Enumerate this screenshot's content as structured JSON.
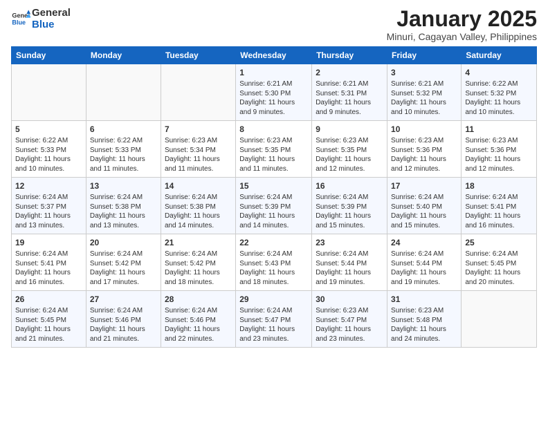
{
  "header": {
    "logo_general": "General",
    "logo_blue": "Blue",
    "month_title": "January 2025",
    "location": "Minuri, Cagayan Valley, Philippines"
  },
  "weekdays": [
    "Sunday",
    "Monday",
    "Tuesday",
    "Wednesday",
    "Thursday",
    "Friday",
    "Saturday"
  ],
  "weeks": [
    [
      {
        "day": "",
        "text": ""
      },
      {
        "day": "",
        "text": ""
      },
      {
        "day": "",
        "text": ""
      },
      {
        "day": "1",
        "text": "Sunrise: 6:21 AM\nSunset: 5:30 PM\nDaylight: 11 hours and 9 minutes."
      },
      {
        "day": "2",
        "text": "Sunrise: 6:21 AM\nSunset: 5:31 PM\nDaylight: 11 hours and 9 minutes."
      },
      {
        "day": "3",
        "text": "Sunrise: 6:21 AM\nSunset: 5:32 PM\nDaylight: 11 hours and 10 minutes."
      },
      {
        "day": "4",
        "text": "Sunrise: 6:22 AM\nSunset: 5:32 PM\nDaylight: 11 hours and 10 minutes."
      }
    ],
    [
      {
        "day": "5",
        "text": "Sunrise: 6:22 AM\nSunset: 5:33 PM\nDaylight: 11 hours and 10 minutes."
      },
      {
        "day": "6",
        "text": "Sunrise: 6:22 AM\nSunset: 5:33 PM\nDaylight: 11 hours and 11 minutes."
      },
      {
        "day": "7",
        "text": "Sunrise: 6:23 AM\nSunset: 5:34 PM\nDaylight: 11 hours and 11 minutes."
      },
      {
        "day": "8",
        "text": "Sunrise: 6:23 AM\nSunset: 5:35 PM\nDaylight: 11 hours and 11 minutes."
      },
      {
        "day": "9",
        "text": "Sunrise: 6:23 AM\nSunset: 5:35 PM\nDaylight: 11 hours and 12 minutes."
      },
      {
        "day": "10",
        "text": "Sunrise: 6:23 AM\nSunset: 5:36 PM\nDaylight: 11 hours and 12 minutes."
      },
      {
        "day": "11",
        "text": "Sunrise: 6:23 AM\nSunset: 5:36 PM\nDaylight: 11 hours and 12 minutes."
      }
    ],
    [
      {
        "day": "12",
        "text": "Sunrise: 6:24 AM\nSunset: 5:37 PM\nDaylight: 11 hours and 13 minutes."
      },
      {
        "day": "13",
        "text": "Sunrise: 6:24 AM\nSunset: 5:38 PM\nDaylight: 11 hours and 13 minutes."
      },
      {
        "day": "14",
        "text": "Sunrise: 6:24 AM\nSunset: 5:38 PM\nDaylight: 11 hours and 14 minutes."
      },
      {
        "day": "15",
        "text": "Sunrise: 6:24 AM\nSunset: 5:39 PM\nDaylight: 11 hours and 14 minutes."
      },
      {
        "day": "16",
        "text": "Sunrise: 6:24 AM\nSunset: 5:39 PM\nDaylight: 11 hours and 15 minutes."
      },
      {
        "day": "17",
        "text": "Sunrise: 6:24 AM\nSunset: 5:40 PM\nDaylight: 11 hours and 15 minutes."
      },
      {
        "day": "18",
        "text": "Sunrise: 6:24 AM\nSunset: 5:41 PM\nDaylight: 11 hours and 16 minutes."
      }
    ],
    [
      {
        "day": "19",
        "text": "Sunrise: 6:24 AM\nSunset: 5:41 PM\nDaylight: 11 hours and 16 minutes."
      },
      {
        "day": "20",
        "text": "Sunrise: 6:24 AM\nSunset: 5:42 PM\nDaylight: 11 hours and 17 minutes."
      },
      {
        "day": "21",
        "text": "Sunrise: 6:24 AM\nSunset: 5:42 PM\nDaylight: 11 hours and 18 minutes."
      },
      {
        "day": "22",
        "text": "Sunrise: 6:24 AM\nSunset: 5:43 PM\nDaylight: 11 hours and 18 minutes."
      },
      {
        "day": "23",
        "text": "Sunrise: 6:24 AM\nSunset: 5:44 PM\nDaylight: 11 hours and 19 minutes."
      },
      {
        "day": "24",
        "text": "Sunrise: 6:24 AM\nSunset: 5:44 PM\nDaylight: 11 hours and 19 minutes."
      },
      {
        "day": "25",
        "text": "Sunrise: 6:24 AM\nSunset: 5:45 PM\nDaylight: 11 hours and 20 minutes."
      }
    ],
    [
      {
        "day": "26",
        "text": "Sunrise: 6:24 AM\nSunset: 5:45 PM\nDaylight: 11 hours and 21 minutes."
      },
      {
        "day": "27",
        "text": "Sunrise: 6:24 AM\nSunset: 5:46 PM\nDaylight: 11 hours and 21 minutes."
      },
      {
        "day": "28",
        "text": "Sunrise: 6:24 AM\nSunset: 5:46 PM\nDaylight: 11 hours and 22 minutes."
      },
      {
        "day": "29",
        "text": "Sunrise: 6:24 AM\nSunset: 5:47 PM\nDaylight: 11 hours and 23 minutes."
      },
      {
        "day": "30",
        "text": "Sunrise: 6:23 AM\nSunset: 5:47 PM\nDaylight: 11 hours and 23 minutes."
      },
      {
        "day": "31",
        "text": "Sunrise: 6:23 AM\nSunset: 5:48 PM\nDaylight: 11 hours and 24 minutes."
      },
      {
        "day": "",
        "text": ""
      }
    ]
  ]
}
